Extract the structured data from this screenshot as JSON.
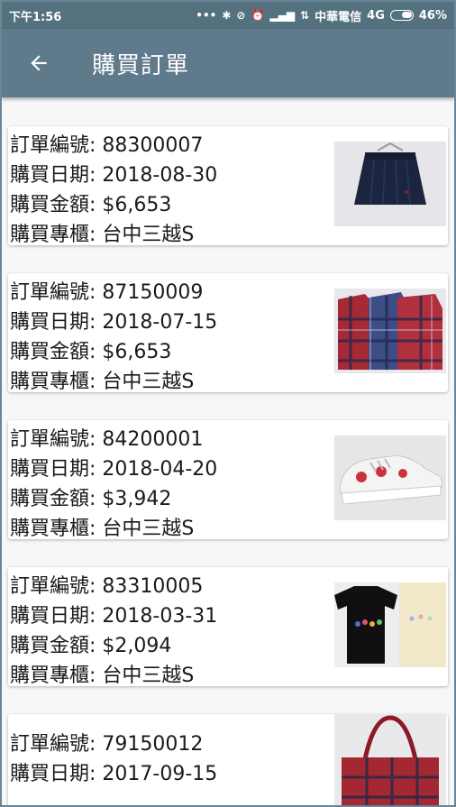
{
  "status_bar": {
    "time": "下午1:56",
    "carrier": "中華電信",
    "network": "4G",
    "battery": "46%"
  },
  "header": {
    "title": "購買訂單"
  },
  "labels": {
    "order_no": "訂單編號",
    "date": "購買日期",
    "amount": "購買金額",
    "counter": "購買專櫃"
  },
  "orders": [
    {
      "order_no": "88300007",
      "date": "2018-08-30",
      "amount": "$6,653",
      "counter": "台中三越S",
      "thumb": "skirt"
    },
    {
      "order_no": "87150009",
      "date": "2018-07-15",
      "amount": "$6,653",
      "counter": "台中三越S",
      "thumb": "plaid-shirts"
    },
    {
      "order_no": "84200001",
      "date": "2018-04-20",
      "amount": "$3,942",
      "counter": "台中三越S",
      "thumb": "sneakers"
    },
    {
      "order_no": "83310005",
      "date": "2018-03-31",
      "amount": "$2,094",
      "counter": "台中三越S",
      "thumb": "t-shirts"
    },
    {
      "order_no": "79150012",
      "date": "2017-09-15",
      "thumb": "tote-bag"
    }
  ]
}
